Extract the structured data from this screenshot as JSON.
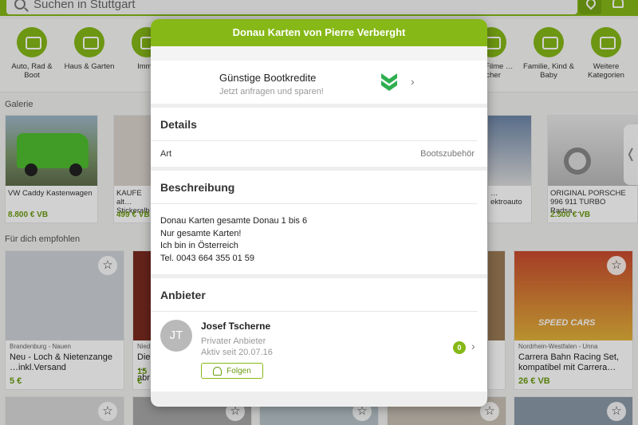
{
  "search": {
    "placeholder": "Suchen in Stuttgart"
  },
  "categories": [
    {
      "label": "Auto, Rad & Boot",
      "icon": "car-icon"
    },
    {
      "label": "Haus & Garten",
      "icon": "sofa-icon"
    },
    {
      "label": "Immo",
      "icon": "house-icon"
    },
    {
      "label": "…k, Filme …ücher",
      "icon": "book-icon"
    },
    {
      "label": "Familie, Kind & Baby",
      "icon": "stroller-icon"
    },
    {
      "label": "Weitere Kategorien",
      "icon": "list-icon"
    }
  ],
  "gallery": {
    "title": "Galerie",
    "items": [
      {
        "title": "VW Caddy Kastenwagen",
        "price": "8.800 € VB"
      },
      {
        "title": "KAUFE alt… Stickeralb…",
        "price": "499 € VB"
      },
      {
        "title": "…ektroauto",
        "price": ""
      },
      {
        "title": "ORIGINAL PORSCHE 996 911 TURBO Radsa…",
        "price": "2.500 € VB"
      }
    ]
  },
  "recommended": {
    "title": "Für dich empfohlen",
    "items": [
      {
        "location": "Brandenburg - Nauen",
        "title": "Neu - Loch & Nietenzange …inkl.Versand",
        "price": "5 €"
      },
      {
        "location": "Nied…",
        "title": "Die … abr…",
        "price": "15 €"
      },
      {
        "location": "Nordrhein-Westfalen - Unna",
        "title": "Carrera Bahn Racing Set, kompatibel mit Carrera…",
        "price": "26 € VB"
      }
    ]
  },
  "modal": {
    "title": "Donau Karten von Pierre Verberght",
    "promo": {
      "title": "Günstige Bootkredite",
      "subtitle": "Jetzt anfragen und sparen!"
    },
    "details": {
      "heading": "Details",
      "rows": [
        {
          "label": "Art",
          "value": "Bootszubehör"
        }
      ]
    },
    "description": {
      "heading": "Beschreibung",
      "lines": [
        "Donau Karten gesamte Donau 1 bis 6",
        "Nur gesamte Karten!",
        "Ich bin in Österreich",
        "Tel. 0043 664 355 01 59"
      ]
    },
    "seller": {
      "heading": "Anbieter",
      "initials": "JT",
      "name": "Josef Tscherne",
      "type": "Privater Anbieter",
      "since": "Aktiv seit 20.07.16",
      "follow_label": "Folgen",
      "ad_count": "0"
    }
  },
  "colors": {
    "accent": "#86b817",
    "accent_dark": "#6b9b10"
  }
}
